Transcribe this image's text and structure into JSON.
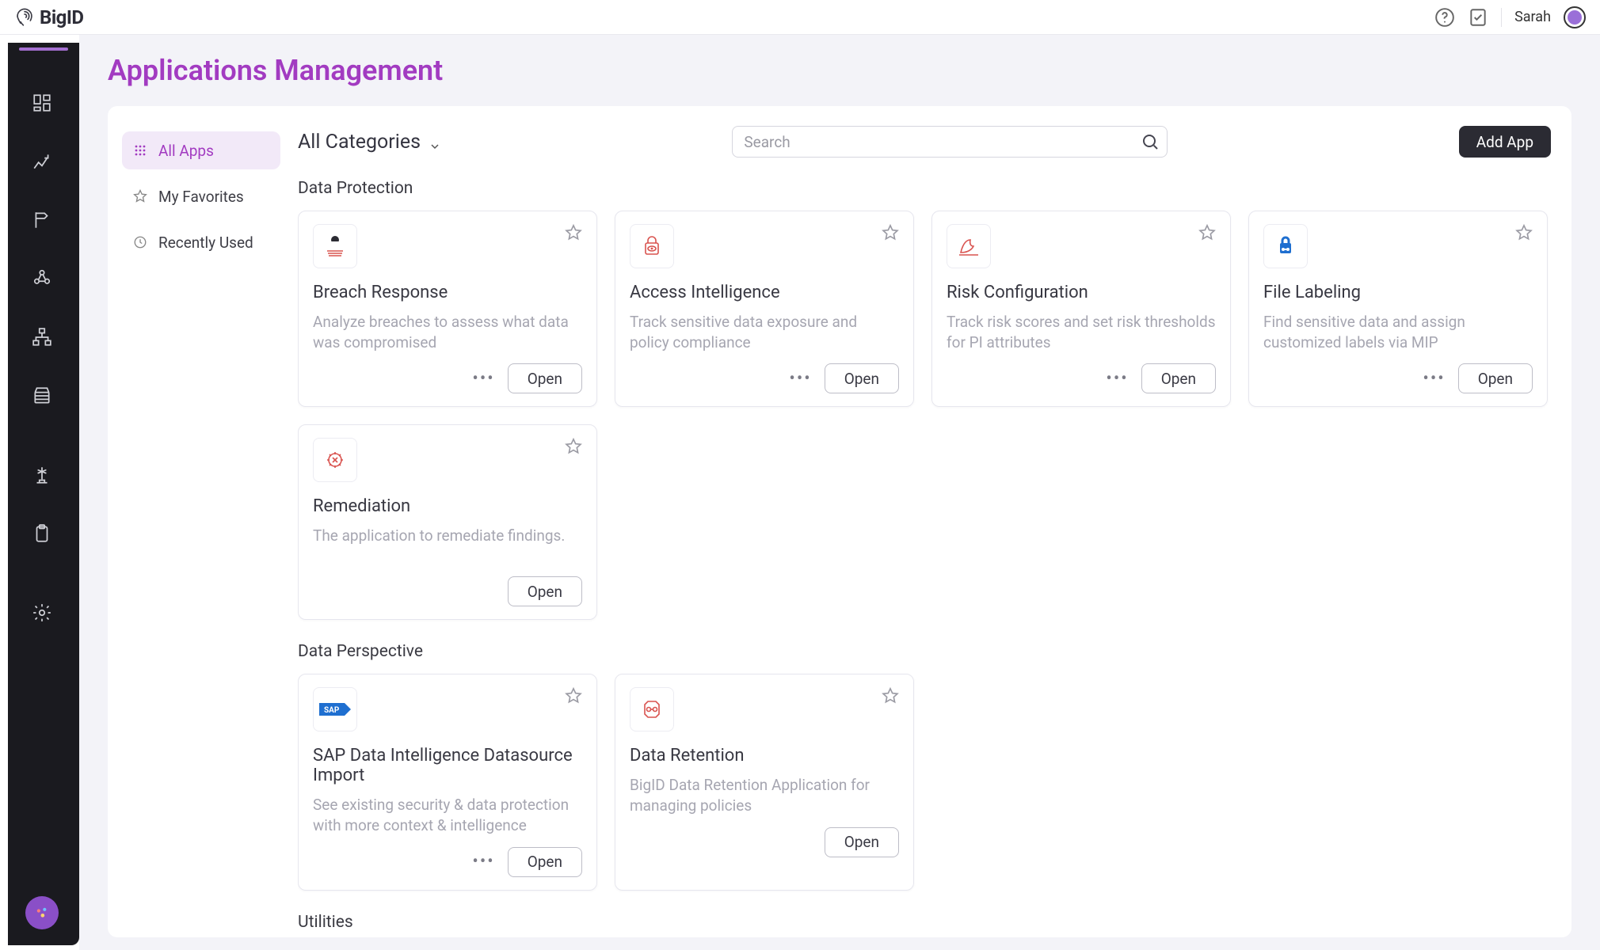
{
  "brand": "BigID",
  "user": {
    "name": "Sarah"
  },
  "header": {
    "title": "Applications Management",
    "category_label": "All Categories",
    "search_placeholder": "Search",
    "add_app_label": "Add App"
  },
  "panel_nav": {
    "all_apps": "All Apps",
    "my_favorites": "My Favorites",
    "recently_used": "Recently Used"
  },
  "sections": {
    "s0": {
      "title": "Data Protection"
    },
    "s1": {
      "title": "Data Perspective"
    },
    "s2": {
      "title": "Utilities"
    }
  },
  "apps": {
    "breach": {
      "title": "Breach Response",
      "desc": "Analyze breaches to assess what data was compromised",
      "open": "Open",
      "has_more": true
    },
    "access": {
      "title": "Access Intelligence",
      "desc": "Track sensitive data exposure and policy compliance",
      "open": "Open",
      "has_more": true
    },
    "risk": {
      "title": "Risk Configuration",
      "desc": "Track risk scores and set risk thresholds for PI attributes",
      "open": "Open",
      "has_more": true
    },
    "file": {
      "title": "File Labeling",
      "desc": "Find sensitive data and assign customized labels via MIP",
      "open": "Open",
      "has_more": true
    },
    "remed": {
      "title": "Remediation",
      "desc": "The application to remediate findings.",
      "open": "Open",
      "has_more": false
    },
    "sap": {
      "title": "SAP Data Intelligence Datasource Import",
      "desc": "See existing security & data protection with more context & intelligence",
      "open": "Open",
      "has_more": true
    },
    "retention": {
      "title": "Data Retention",
      "desc": "BigID Data Retention Application for managing policies",
      "open": "Open",
      "has_more": false
    }
  }
}
